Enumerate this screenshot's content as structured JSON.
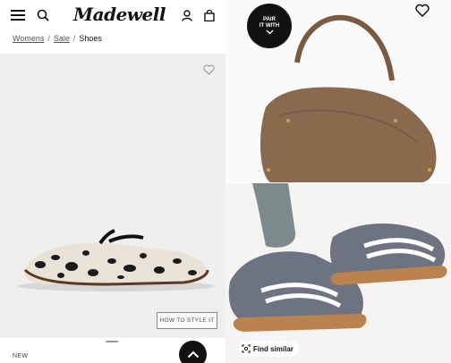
{
  "header": {
    "logo": "Madewell",
    "icons": [
      "menu-icon",
      "search-icon",
      "account-icon",
      "bag-icon"
    ]
  },
  "breadcrumb": {
    "items": [
      {
        "label": "Womens"
      },
      {
        "label": "Sale"
      },
      {
        "label": "Shoes"
      }
    ],
    "separator": "/"
  },
  "product": {
    "style_button": "HOW TO STYLE IT",
    "tag": "NEW",
    "background": "#efefef"
  },
  "pair_panel": {
    "badge_line1": "PAIR",
    "badge_line2": "IT WITH",
    "find_similar": "Find similar"
  },
  "colors": {
    "badge": "#111111",
    "bag": "#8a6a4f",
    "sneaker": "#6d7380"
  }
}
